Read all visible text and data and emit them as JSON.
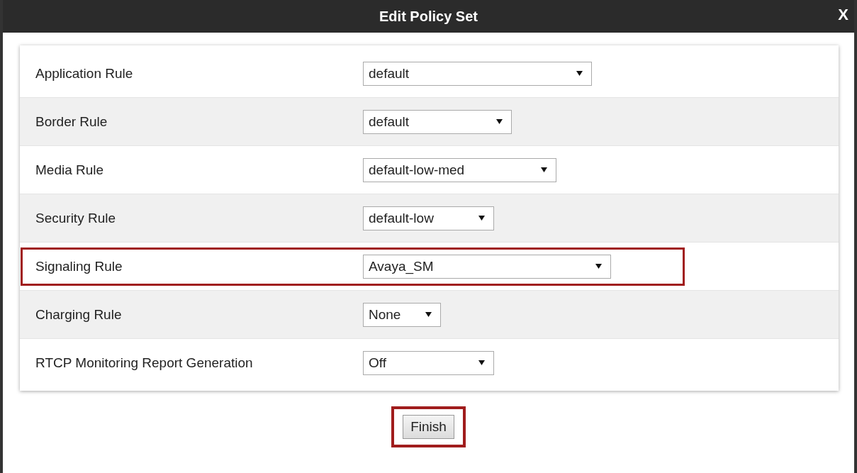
{
  "dialog": {
    "title": "Edit Policy Set",
    "close": "X"
  },
  "rules": [
    {
      "label": "Application Rule",
      "value": "default",
      "highlighted": false
    },
    {
      "label": "Border Rule",
      "value": "default",
      "highlighted": false
    },
    {
      "label": "Media Rule",
      "value": "default-low-med",
      "highlighted": false
    },
    {
      "label": "Security Rule",
      "value": "default-low",
      "highlighted": false
    },
    {
      "label": "Signaling Rule",
      "value": "Avaya_SM",
      "highlighted": true
    },
    {
      "label": "Charging Rule",
      "value": "None",
      "highlighted": false
    },
    {
      "label": "RTCP Monitoring Report Generation",
      "value": "Off",
      "highlighted": false
    }
  ],
  "finish_button": {
    "label": "Finish",
    "highlighted": true
  }
}
